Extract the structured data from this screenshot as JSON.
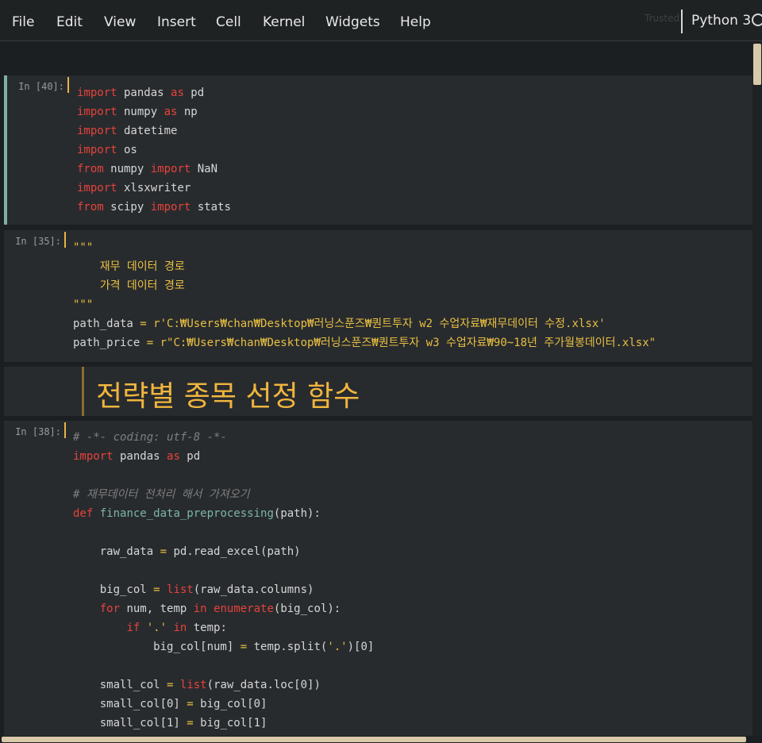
{
  "menu": {
    "items": [
      "File",
      "Edit",
      "View",
      "Insert",
      "Cell",
      "Kernel",
      "Widgets",
      "Help"
    ],
    "trusted_label": "Trusted",
    "kernel_name": "Python 3"
  },
  "cells": {
    "cell1": {
      "prompt": "In [40]:",
      "lines": [
        [
          [
            "kw",
            "import"
          ],
          [
            "t",
            " pandas "
          ],
          [
            "kw",
            "as"
          ],
          [
            "t",
            " pd"
          ]
        ],
        [
          [
            "kw",
            "import"
          ],
          [
            "t",
            " numpy "
          ],
          [
            "kw",
            "as"
          ],
          [
            "t",
            " np"
          ]
        ],
        [
          [
            "kw",
            "import"
          ],
          [
            "t",
            " datetime"
          ]
        ],
        [
          [
            "kw",
            "import"
          ],
          [
            "t",
            " os"
          ]
        ],
        [
          [
            "kw",
            "from"
          ],
          [
            "t",
            " numpy "
          ],
          [
            "kw",
            "import"
          ],
          [
            "t",
            " NaN"
          ]
        ],
        [
          [
            "kw",
            "import"
          ],
          [
            "t",
            " xlsxwriter"
          ]
        ],
        [
          [
            "kw",
            "from"
          ],
          [
            "t",
            " scipy "
          ],
          [
            "kw",
            "import"
          ],
          [
            "t",
            " stats"
          ]
        ]
      ]
    },
    "cell2": {
      "prompt": "In [35]:",
      "lines": [
        [
          [
            "str",
            "\"\"\""
          ]
        ],
        [
          [
            "str",
            "    재무 데이터 경로"
          ]
        ],
        [
          [
            "str",
            "    가격 데이터 경로"
          ]
        ],
        [
          [
            "str",
            "\"\"\""
          ]
        ],
        [
          [
            "t",
            "path_data "
          ],
          [
            "op",
            "="
          ],
          [
            "t",
            " "
          ],
          [
            "str",
            "r'C:₩Users₩chan₩Desktop₩러닝스푼즈₩퀀트투자 w2 수업자료₩재무데이터 수정.xlsx'"
          ]
        ],
        [
          [
            "t",
            "path_price "
          ],
          [
            "op",
            "="
          ],
          [
            "t",
            " "
          ],
          [
            "str",
            "r\"C:₩Users₩chan₩Desktop₩러닝스푼즈₩퀀트투자 w3 수업자료₩90~18년 주가월봉데이터.xlsx\""
          ]
        ]
      ]
    },
    "markdown": {
      "heading": "전략별 종목 선정 함수"
    },
    "cell3": {
      "prompt": "In [38]:",
      "lines": [
        [
          [
            "cm",
            "# -*- coding: utf-8 -*-"
          ]
        ],
        [
          [
            "kw",
            "import"
          ],
          [
            "t",
            " pandas "
          ],
          [
            "kw",
            "as"
          ],
          [
            "t",
            " pd"
          ]
        ],
        [
          [
            "t",
            ""
          ]
        ],
        [
          [
            "cm",
            "# 재무데이터 전처리 해서 가져오기"
          ]
        ],
        [
          [
            "kw",
            "def"
          ],
          [
            "t",
            " "
          ],
          [
            "fn",
            "finance_data_preprocessing"
          ],
          [
            "t",
            "(path):"
          ]
        ],
        [
          [
            "t",
            ""
          ]
        ],
        [
          [
            "t",
            "    raw_data "
          ],
          [
            "op",
            "="
          ],
          [
            "t",
            " pd.read_excel(path)"
          ]
        ],
        [
          [
            "t",
            ""
          ]
        ],
        [
          [
            "t",
            "    big_col "
          ],
          [
            "op",
            "="
          ],
          [
            "t",
            " "
          ],
          [
            "bi",
            "list"
          ],
          [
            "t",
            "(raw_data.columns)"
          ]
        ],
        [
          [
            "t",
            "    "
          ],
          [
            "kw",
            "for"
          ],
          [
            "t",
            " num, temp "
          ],
          [
            "kw",
            "in"
          ],
          [
            "t",
            " "
          ],
          [
            "bi",
            "enumerate"
          ],
          [
            "t",
            "(big_col):"
          ]
        ],
        [
          [
            "t",
            "        "
          ],
          [
            "kw",
            "if"
          ],
          [
            "t",
            " "
          ],
          [
            "str",
            "'.'"
          ],
          [
            "t",
            " "
          ],
          [
            "kw",
            "in"
          ],
          [
            "t",
            " temp:"
          ]
        ],
        [
          [
            "t",
            "            big_col[num] "
          ],
          [
            "op",
            "="
          ],
          [
            "t",
            " temp.split("
          ],
          [
            "str",
            "'.'"
          ],
          [
            "t",
            ")[0]"
          ]
        ],
        [
          [
            "t",
            ""
          ]
        ],
        [
          [
            "t",
            "    small_col "
          ],
          [
            "op",
            "="
          ],
          [
            "t",
            " "
          ],
          [
            "bi",
            "list"
          ],
          [
            "t",
            "(raw_data.loc[0])"
          ]
        ],
        [
          [
            "t",
            "    small_col[0] "
          ],
          [
            "op",
            "="
          ],
          [
            "t",
            " big_col[0]"
          ]
        ],
        [
          [
            "t",
            "    small_col[1] "
          ],
          [
            "op",
            "="
          ],
          [
            "t",
            " big_col[1]"
          ]
        ]
      ]
    }
  },
  "colors": {
    "keyword": "#e6423b",
    "string": "#e8bf42",
    "comment": "#7e7e7e",
    "function": "#7cb6a5",
    "selected_border": "#7cb1a2",
    "heading": "#f0b53e"
  }
}
